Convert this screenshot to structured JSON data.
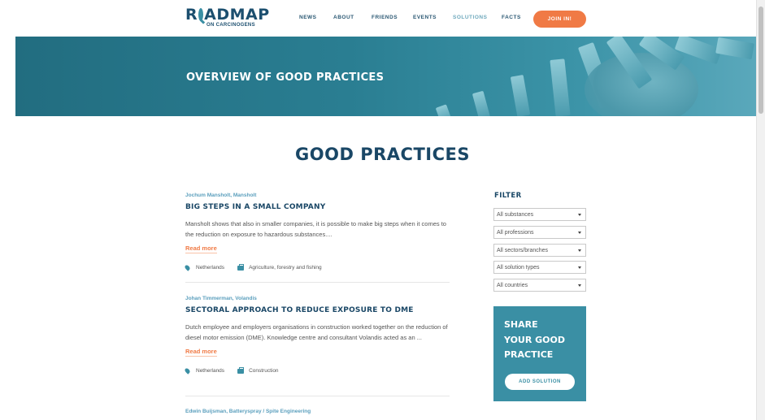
{
  "logo": {
    "main_pre": "R",
    "main_post": "ADMAP",
    "sub": "ON CARCINOGENS"
  },
  "nav": {
    "items": [
      {
        "label": "NEWS",
        "active": false
      },
      {
        "label": "ABOUT",
        "active": false
      },
      {
        "label": "FRIENDS",
        "active": false
      },
      {
        "label": "EVENTS",
        "active": false
      },
      {
        "label": "SOLUTIONS",
        "active": true
      },
      {
        "label": "FACTS",
        "active": false
      }
    ],
    "join_label": "JOIN IN!"
  },
  "hero": {
    "title": "OVERVIEW OF GOOD PRACTICES"
  },
  "main": {
    "title": "GOOD PRACTICES",
    "practices": [
      {
        "author": "Jochum Mansholt, Mansholt",
        "title": "BIG STEPS IN A SMALL COMPANY",
        "description": "Mansholt shows that also in smaller companies, it is possible to make big steps when it comes to the reduction on exposure to hazardous substances....",
        "read_more": "Read more",
        "country": "Netherlands",
        "sector": "Agriculture, forestry and fishing"
      },
      {
        "author": "Johan Timmerman, Volandis",
        "title": "SECTORAL APPROACH TO REDUCE EXPOSURE TO DME",
        "description": "Dutch employee and employers organisations in construction worked together on the reduction of diesel motor emission (DME). Knowledge centre and consultant Volandis acted as an ...",
        "read_more": "Read more",
        "country": "Netherlands",
        "sector": "Construction"
      },
      {
        "author": "Edwin Buijsman, Batteryspray / Spite Engineering"
      }
    ]
  },
  "filter": {
    "title": "FILTER",
    "selects": [
      {
        "value": "All substances"
      },
      {
        "value": "All professions"
      },
      {
        "value": "All sectors/branches"
      },
      {
        "value": "All solution types"
      },
      {
        "value": "All countries"
      }
    ]
  },
  "share": {
    "line1": "SHARE",
    "line2": "YOUR GOOD",
    "line3": "PRACTICE",
    "button": "ADD SOLUTION"
  },
  "colors": {
    "brand_dark": "#1a4766",
    "brand_teal": "#3a8fa4",
    "accent_orange": "#f07a45",
    "author_blue": "#5b9fbd"
  },
  "icons": {
    "location": "map-pin-icon",
    "sector": "briefcase-icon",
    "dropdown": "caret-down-icon"
  }
}
